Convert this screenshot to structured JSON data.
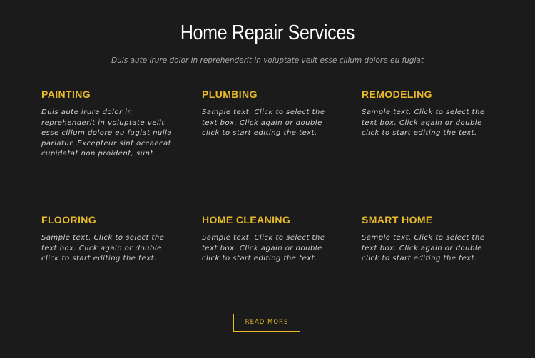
{
  "header": {
    "title": "Home Repair Services",
    "subtitle": "Duis aute irure dolor in reprehenderit in voluptate velit esse cillum dolore eu fugiat"
  },
  "services": [
    {
      "title": "PAINTING",
      "text": "Duis aute irure dolor in reprehenderit in voluptate velit esse cillum dolore eu fugiat nulla pariatur. Excepteur sint occaecat cupidatat non proident, sunt"
    },
    {
      "title": "PLUMBING",
      "text": "Sample text. Click to select the text box. Click again or double click to start editing the text."
    },
    {
      "title": "REMODELING",
      "text": "Sample text. Click to select the text box. Click again or double click to start editing the text."
    },
    {
      "title": "FLOORING",
      "text": "Sample text. Click to select the text box. Click again or double click to start editing the text."
    },
    {
      "title": "HOME CLEANING",
      "text": "Sample text. Click to select the text box. Click again or double click to start editing the text."
    },
    {
      "title": "SMART HOME",
      "text": "Sample text. Click to select the text box. Click again or double click to start editing the text."
    }
  ],
  "cta": {
    "label": "READ MORE"
  },
  "colors": {
    "background": "#1b1b1b",
    "accent": "#e8b92a",
    "title": "#ffffff",
    "body_text": "#d4d4d4"
  }
}
